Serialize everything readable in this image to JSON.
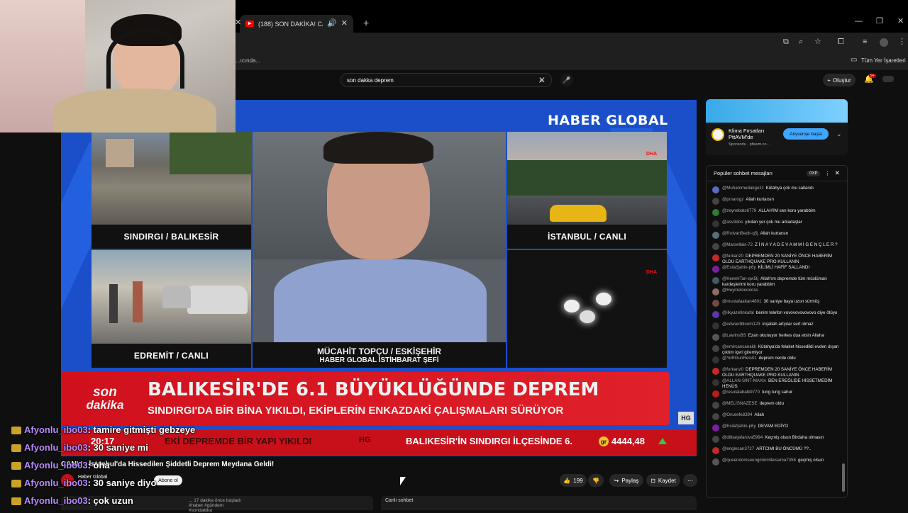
{
  "browser": {
    "tab_title": "(188) SON DAKİKA! CANLI",
    "left_tab_fragment": "...ıcında...",
    "bookmark_label": "Tüm Yer İşaretleri"
  },
  "youtube": {
    "search_value": "son dakka deprem",
    "create_label": "Oluştur",
    "notif_count": "9+"
  },
  "video": {
    "channel_logo": "HABER GLOBAL",
    "cells": [
      {
        "caption": "SINDIRGI / BALIKESİR"
      },
      {
        "caption": "EDREMİT / CANLI"
      },
      {
        "caption": "MÜCAHİT TOPÇU / ESKİŞEHİR",
        "subcaption": "HABER GLOBAL İSTİHBARAT ŞEFİ"
      },
      {
        "caption": "İSTANBUL / CANLI"
      },
      {
        "caption": ""
      }
    ],
    "dha_tag": "DHA",
    "son": "son",
    "dakika": "dakika",
    "headline": "BALIKESİR'DE 6.1 BÜYÜKLÜĞÜNDE DEPREM",
    "subheadline": "SINDIRGI'DA BİR BİNA YIKILDI, EKİPLERİN ENKAZDAKİ ÇALIŞMALARI SÜRÜYOR",
    "hg_badge": "HG",
    "ticker_time": "20:17",
    "ticker_text_1": "EKİ DEPREMDE BİR YAPI YIKILDI",
    "ticker_text_2": "BALIKESİR'İN SINDIRGI İLÇESİNDE 6.",
    "ticker_gr": "gr",
    "ticker_value": "4444,48"
  },
  "overlay_chat": [
    {
      "user": "Afyonlu_ibo03",
      "msg": ": tamire gitmişti gebzeye"
    },
    {
      "user": "Afyonlu_ibo03",
      "msg": ": 30 saniye mi"
    },
    {
      "user": "Afyonlu_ibo03",
      "msg": ": oha"
    },
    {
      "user": "Afyonlu_ibo03",
      "msg": ": 30 saniye diyo"
    },
    {
      "user": "Afyonlu_ibo03",
      "msg": ": çok uzun"
    }
  ],
  "video_title": "CANLI - İstanbul'da Hissedilen Şiddetli Deprem Meydana Geldi!",
  "channel_name": "Haber Global",
  "subscribe_label": "Abone ol",
  "actions": {
    "likes": "199",
    "share": "Paylaş",
    "save": "Kaydet"
  },
  "meta_line": "... 17 dakika önce başladı  #haber #gündem #sondakika",
  "live_chat_label": "Canlı sohbet",
  "ad": {
    "title": "Klima Fırsatları PttAVM'de",
    "sponsor": "Sponsorlu · pttavm.co...",
    "cta": "Alışverişe başla"
  },
  "chat": {
    "header": "Popüler sohbet mesajları",
    "points": "0XP",
    "messages": [
      {
        "user": "@Muhammedakgozz",
        "text": "Kütahya çok mu sallandı",
        "color": "#5c6bc0"
      },
      {
        "user": "@pınarogz",
        "text": "Allah kurtarsın",
        "color": "#444"
      },
      {
        "user": "@zeynebats6779",
        "text": "ALLAH'IM sen koru yarabbim",
        "color": "#2e7d32"
      },
      {
        "user": "@asv3dos",
        "text": "yıkılan yer çok mu arkadaşlar",
        "color": "#333"
      },
      {
        "user": "@RıdvanBedir-q5j",
        "text": "Allah kurtarsın",
        "color": "#546e7a"
      },
      {
        "user": "@Marsellais-72",
        "text": "Z İ N A Y A D E V A M M İ G E N Ç L E R ?",
        "color": "#444"
      },
      {
        "user": "@furkanz0",
        "text": "DEPREMDEN 20 SANİYE ÖNCE HABERİM OLDU EARTHQUAKE PRO KULLANIN",
        "color": "#c62828"
      },
      {
        "user": "@EsilaŞahin-p6y",
        "text": "KİLİMLİ HAFİF SALLANDI",
        "color": "#7b1fa2"
      },
      {
        "user": "@KeremTan-qw5tj",
        "text": "Allah'ım depremde tüm müslüman kardeşlerimi koru yarabbim",
        "color": "#455a64"
      },
      {
        "user": "@Heymeloooooss",
        "text": "",
        "color": "#8d6e63"
      },
      {
        "user": "@mustafaaltan4801",
        "text": "30 saniye baya uzun sürmüş",
        "color": "#6d4c41"
      },
      {
        "user": "@ilkyazefinkafal",
        "text": "benim telefon vovovovovovovo diye ötüyo",
        "color": "#5e35b1"
      },
      {
        "user": "@edwardbloom123",
        "text": "inşallah artçılar sert olmaz",
        "color": "#333"
      },
      {
        "user": "@LawinsBS",
        "text": "Ezan okunuyor herkes dua etsin Allaha",
        "color": "#555"
      },
      {
        "user": "@emircancanakk",
        "text": "Kütahya'da felaket hissedildi evden dışarı çıktım içeri giremiyor",
        "color": "#444"
      },
      {
        "user": "@YoRGunReis01",
        "text": "deprem nerde oldu",
        "color": "#333"
      },
      {
        "user": "@furkanz0",
        "text": "DEPREMDEN 20 SANİYE ÖNCE HABERİM OLDU EARTHQUAKE PRO KULLANIN",
        "color": "#c62828"
      },
      {
        "user": "@ALLAN-SİNT-MAXtv",
        "text": "BEN EREĞLİDE HİSSETMEDİM HENÜS",
        "color": "#333"
      },
      {
        "user": "@resulalabalk9770",
        "text": "tung tung sahur",
        "color": "#b71c1c"
      },
      {
        "user": "@MELİSNAZESE",
        "text": "deprem oldu",
        "color": "#444"
      },
      {
        "user": "@Onurefe8394",
        "text": "Allah",
        "color": "#444"
      },
      {
        "user": "@EsilaŞahin-p6y",
        "text": "DEVAM EDİYO",
        "color": "#7b1fa2"
      },
      {
        "user": "@dilbarjafarova5994",
        "text": "Keçmiş olsun Birdaha olmasın",
        "color": "#444"
      },
      {
        "user": "@engincan3727",
        "text": "ARTCIMI BU ÖNCÜMÜ ??..",
        "color": "#c62828"
      },
      {
        "user": "@queendomseungminmileisama7358",
        "text": "geçmiş olsun",
        "color": "#555"
      }
    ]
  },
  "colors": {
    "yt_red": "#ff0000",
    "hg_red": "#d0101c",
    "hg_blue": "#1a4fc9",
    "username_purple": "#b78cff"
  }
}
